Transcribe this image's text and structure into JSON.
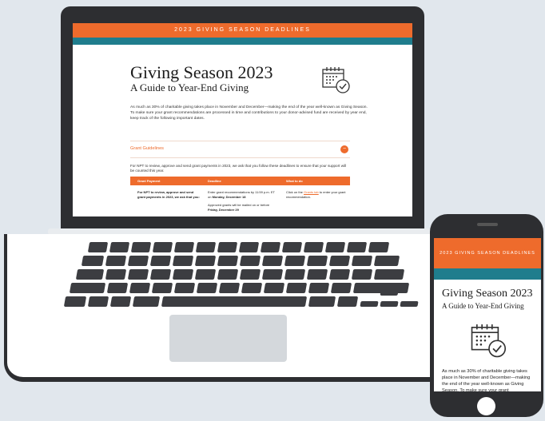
{
  "laptop_page": {
    "banner": "2023 GIVING SEASON DEADLINES",
    "title": "Giving Season 2023",
    "subtitle": "A Guide to Year-End Giving",
    "intro": "As much as 30% of charitable giving takes place in November and December—making the end of the year well-known as Giving Season. To make sure your grant recommendations are processed in time and contributions to your donor-advised fund are received by year end, keep track of the following important dates.",
    "accordion_label": "Grant Guidelines",
    "accordion_toggle": "−",
    "policy": "For NPT to review, approve and send grant payments in 2023, we ask that you follow these deadlines to ensure that your support will be counted this year.",
    "table": {
      "headers": [
        "Grant Payment",
        "Deadline",
        "What to do"
      ],
      "row_col1": "For NPT to review, approve and send grant payments in 2023, we ask that you:",
      "row_col2_a": "Enter grant recommendations by 11:59 p.m. ET on ",
      "row_col2_a_bold": "Monday, December 18",
      "row_col2_b": "Approved grants will be mailed on or before ",
      "row_col2_b_bold": "Friday, December 29",
      "row_col3_pre": "Click on the ",
      "row_col3_link": "Grants tab",
      "row_col3_post": " to enter your grant recommendation."
    }
  },
  "phone_page": {
    "banner": "2023 GIVING SEASON DEADLINES",
    "title": "Giving Season 2023",
    "subtitle": "A Guide to Year-End Giving",
    "intro": "As much as 30% of charitable giving takes place in November and December—making the end of the year well-known as Giving Season. To make sure your grant"
  },
  "icons": [
    "calendar-check-icon",
    "minus-icon"
  ],
  "colors": {
    "accent_orange": "#ee6b2c",
    "teal": "#1f7d8d",
    "device_dark": "#2d2e31",
    "backdrop": "#e1e7ed"
  }
}
